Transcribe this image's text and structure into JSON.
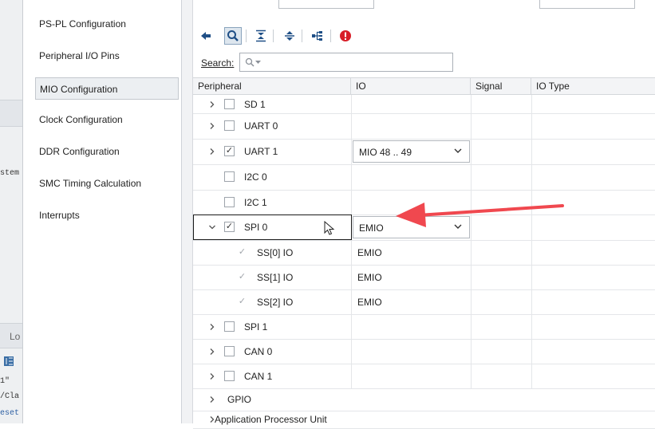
{
  "background_app": {
    "fragments": [
      "stem",
      "Lo",
      "1\"",
      "/Cla",
      "eset"
    ]
  },
  "nav": {
    "items": [
      {
        "label": "PS-PL Configuration",
        "selected": false
      },
      {
        "label": "Peripheral I/O Pins",
        "selected": false
      },
      {
        "label": "MIO Configuration",
        "selected": true
      },
      {
        "label": "Clock Configuration",
        "selected": false
      },
      {
        "label": "DDR Configuration",
        "selected": false
      },
      {
        "label": "SMC Timing Calculation",
        "selected": false
      },
      {
        "label": "Interrupts",
        "selected": false
      }
    ]
  },
  "toolbar": {
    "icons": [
      "back-arrow-icon",
      "search-icon",
      "collapse-all-icon",
      "expand-all-icon",
      "hierarchy-icon",
      "error-icon"
    ]
  },
  "search": {
    "label": "Search:",
    "placeholder": "Q-"
  },
  "grid": {
    "columns": [
      "Peripheral",
      "IO",
      "Signal",
      "IO Type"
    ],
    "rows": [
      {
        "name": "SD 1",
        "checked": false,
        "expandable": true,
        "io": ""
      },
      {
        "name": "UART 0",
        "checked": false,
        "expandable": true,
        "io": ""
      },
      {
        "name": "UART 1",
        "checked": true,
        "expandable": true,
        "io": "MIO 48 .. 49",
        "io_dropdown": true
      },
      {
        "name": "I2C 0",
        "checked": false,
        "expandable": false,
        "io": ""
      },
      {
        "name": "I2C 1",
        "checked": false,
        "expandable": false,
        "io": ""
      },
      {
        "name": "SPI 0",
        "checked": true,
        "expandable": true,
        "expanded": true,
        "io": "EMIO",
        "io_dropdown": true
      },
      {
        "name": "SS[0] IO",
        "checked": true,
        "disabled": true,
        "child": true,
        "io": "EMIO"
      },
      {
        "name": "SS[1] IO",
        "checked": true,
        "disabled": true,
        "child": true,
        "io": "EMIO"
      },
      {
        "name": "SS[2] IO",
        "checked": true,
        "disabled": true,
        "child": true,
        "io": "EMIO"
      },
      {
        "name": "SPI 1",
        "checked": false,
        "expandable": true,
        "io": ""
      },
      {
        "name": "CAN 0",
        "checked": false,
        "expandable": true,
        "io": ""
      },
      {
        "name": "CAN 1",
        "checked": false,
        "expandable": true,
        "io": ""
      },
      {
        "name": "GPIO",
        "group": true,
        "expandable": true
      },
      {
        "name": "Application Processor Unit",
        "group": true,
        "expandable": true
      }
    ]
  },
  "colors": {
    "annotation_arrow": "#f0484f",
    "error_icon": "#d81e28",
    "toolbar_icon": "#1f4f86"
  }
}
